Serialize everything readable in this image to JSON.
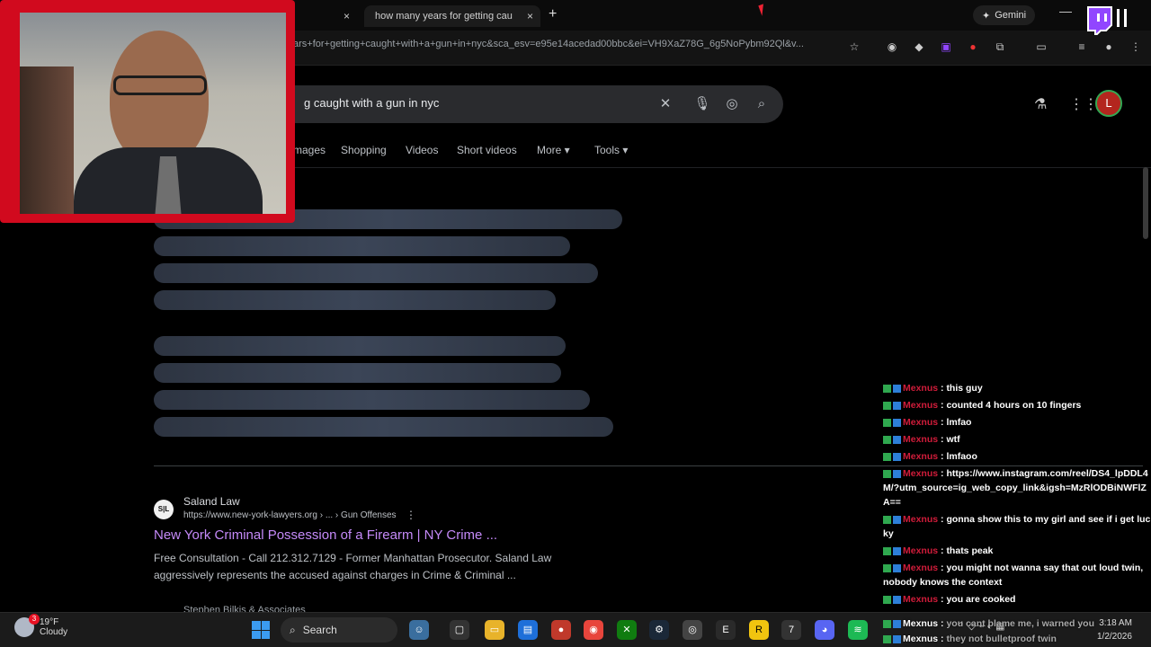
{
  "browser": {
    "active_tab_title": "how many years for getting cau",
    "inactive_tab_close": "×",
    "url": "ars+for+getting+caught+with+a+gun+in+nyc&sca_esv=e95e14acedad00bbc&ei=VH9XaZ78G_6g5NoPybm92Ql&v...",
    "gemini_label": "Gemini"
  },
  "search": {
    "query_visible": "g caught with a gun in nyc",
    "avatar_letter": "L",
    "nav": [
      "mages",
      "Shopping",
      "Videos",
      "Short videos",
      "More",
      "Tools"
    ]
  },
  "result": {
    "favicon_text": "S|L",
    "site_name": "Saland Law",
    "site_url": "https://www.new-york-lawyers.org › ... › Gun Offenses",
    "title": "New York Criminal Possession of a Firearm | NY Crime ...",
    "snippet": "Free Consultation - Call 212.312.7129 - Former Manhattan Prosecutor. Saland Law aggressively represents the accused against charges in Crime & Criminal ...",
    "next_site": "Stephen Bilkis & Associates"
  },
  "chat": {
    "messages": [
      {
        "user": "Mexnus",
        "text": "this guy"
      },
      {
        "user": "Mexnus",
        "text": "counted 4 hours on 10 fingers"
      },
      {
        "user": "Mexnus",
        "text": "lmfao"
      },
      {
        "user": "Mexnus",
        "text": "wtf"
      },
      {
        "user": "Mexnus",
        "text": "lmfaoo"
      },
      {
        "user": "Mexnus",
        "text": "https://www.instagram.com/reel/DS4_lpDDL4M/?utm_source=ig_web_copy_link&igsh=MzRlODBiNWFlZA=="
      },
      {
        "user": "Mexnus",
        "text": "gonna show this to my girl and see if i get lucky"
      },
      {
        "user": "Mexnus",
        "text": "thats peak"
      },
      {
        "user": "Mexnus",
        "text": "you might not wanna say that out loud twin, nobody knows the context"
      },
      {
        "user": "Mexnus",
        "text": "you are cooked"
      },
      {
        "user": "Mexnus",
        "text": "you cant blame me, i warned you"
      },
      {
        "user": "Mexnus",
        "text": "they not bulletproof twin"
      }
    ]
  },
  "taskbar": {
    "weather_temp": "19°F",
    "weather_desc": "Cloudy",
    "weather_badge": "3",
    "search_label": "Search",
    "time": "3:18 AM",
    "date": "1/2/2026"
  },
  "colors": {
    "webcam_border": "#d10a1e",
    "chat_username": "#d01c3a",
    "visited_link": "#c58af9",
    "twitch": "#9146ff"
  }
}
